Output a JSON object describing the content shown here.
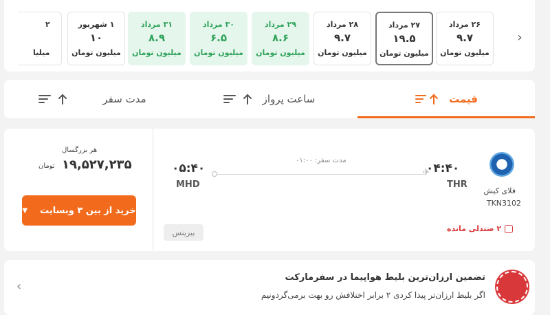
{
  "date_strip": {
    "cards": [
      {
        "date": "۲۶ مرداد",
        "price": "۹.۷",
        "unit": "میلیون تومان",
        "state": "normal"
      },
      {
        "date": "۲۷ مرداد",
        "price": "۱۹.۵",
        "unit": "میلیون تومان",
        "state": "selected"
      },
      {
        "date": "۲۸ مرداد",
        "price": "۹.۷",
        "unit": "میلیون تومان",
        "state": "normal"
      },
      {
        "date": "۲۹ مرداد",
        "price": "۸.۶",
        "unit": "میلیون تومان",
        "state": "green"
      },
      {
        "date": "۳۰ مرداد",
        "price": "۶.۵",
        "unit": "میلیون تومان",
        "state": "green"
      },
      {
        "date": "۳۱ مرداد",
        "price": "۸.۹",
        "unit": "میلیون تومان",
        "state": "green"
      },
      {
        "date": "۱ شهریور",
        "price": "۱۰",
        "unit": "میلیون تومان",
        "state": "normal"
      },
      {
        "date": "۲",
        "price": "",
        "unit": "میلیا",
        "state": "partial"
      }
    ],
    "prev_icon": "chevron-right-icon",
    "next_icon": "chevron-left-icon"
  },
  "sort_bar": {
    "tabs": [
      {
        "label": "قیمت",
        "active": true
      },
      {
        "label": "ساعت پرواز",
        "active": false
      },
      {
        "label": "مدت سفر",
        "active": false
      }
    ]
  },
  "flight": {
    "airline_name": "فلای کیش",
    "flight_number": "TKN3102",
    "departure_time": "۰۴:۴۰",
    "departure_code": "THR",
    "arrival_time": "۰۵:۴۰",
    "arrival_code": "MHD",
    "duration": "مدت سفر: ۰۱:۰۰",
    "seats_left": "۲ صندلی مانده",
    "cabin_class": "بیزینس",
    "price_label": "هر بزرگسال",
    "price": "۱۹,۵۲۷,۲۳۵",
    "currency": "تومان",
    "buy_label": "خرید از بین ۳ وبسایت"
  },
  "guarantee": {
    "title": "تضمین ارزان‌ترین بلیط هواپیما در سفرمارکت",
    "subtitle": "اگر بلیط ارزان‌تر پیدا کردی ۲ برابر اختلافش رو بهت برمی‌گردونیم"
  },
  "colors": {
    "accent": "#f26b1d",
    "green": "#2fa35a",
    "green_bg": "#e5f6ec",
    "red": "#d9383a"
  }
}
